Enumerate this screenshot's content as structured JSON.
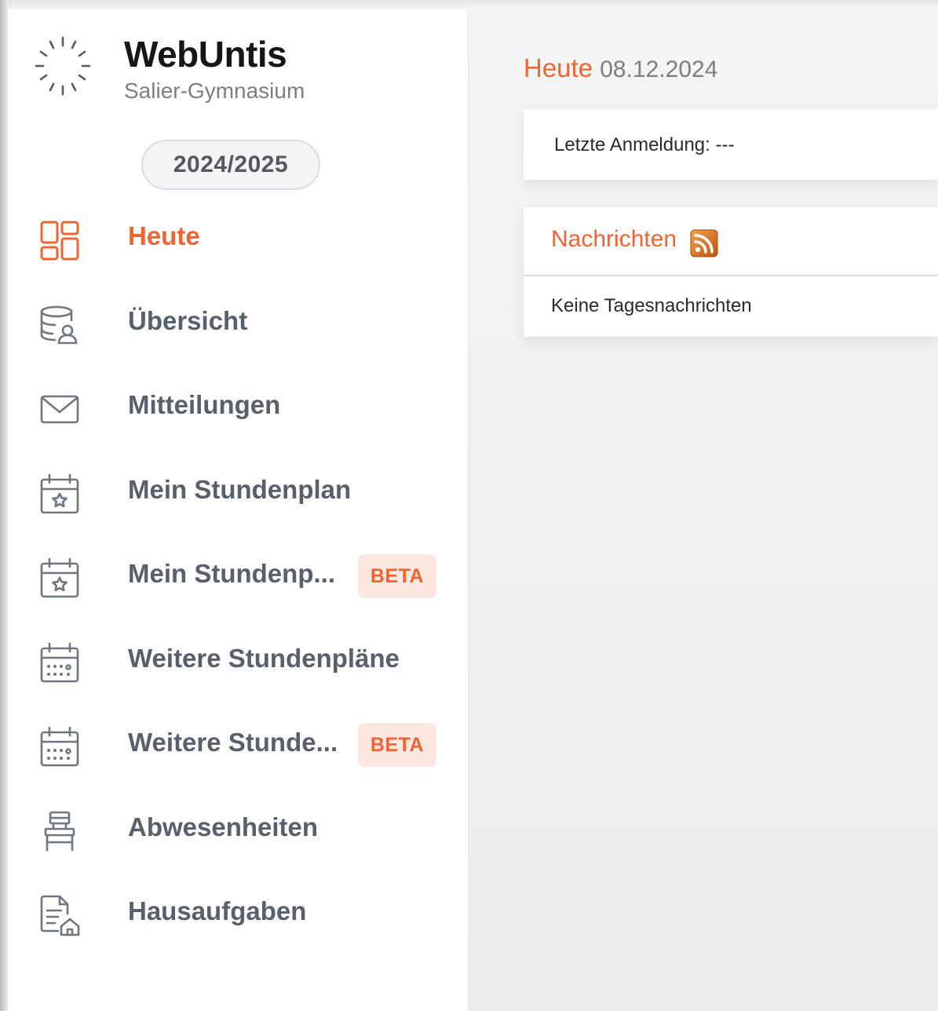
{
  "brand": {
    "title": "WebUntis",
    "school": "Salier-Gymnasium",
    "school_year": "2024/2025"
  },
  "sidebar": {
    "items": [
      {
        "label": "Heute",
        "icon": "dashboard-icon",
        "active": true
      },
      {
        "label": "Übersicht",
        "icon": "database-user-icon",
        "active": false
      },
      {
        "label": "Mitteilungen",
        "icon": "envelope-icon",
        "active": false
      },
      {
        "label": "Mein Stundenplan",
        "icon": "calendar-star-icon",
        "active": false
      },
      {
        "label": "Mein Stundenp...",
        "icon": "calendar-star-icon",
        "active": false,
        "badge": "BETA"
      },
      {
        "label": "Weitere Stundenpläne",
        "icon": "calendar-grid-icon",
        "active": false
      },
      {
        "label": "Weitere Stunde...",
        "icon": "calendar-grid-icon",
        "active": false,
        "badge": "BETA"
      },
      {
        "label": "Abwesenheiten",
        "icon": "chair-icon",
        "active": false
      },
      {
        "label": "Hausaufgaben",
        "icon": "document-home-icon",
        "active": false
      }
    ]
  },
  "main": {
    "title": "Heute",
    "date": "08.12.2024",
    "last_login": "Letzte Anmeldung: ---",
    "news": {
      "title": "Nachrichten",
      "empty_text": "Keine Tagesnachrichten"
    }
  },
  "colors": {
    "accent": "#ee6433",
    "nav_text": "#58606b",
    "icon_stroke": "#6f7680",
    "background": "#f0f0f1"
  }
}
